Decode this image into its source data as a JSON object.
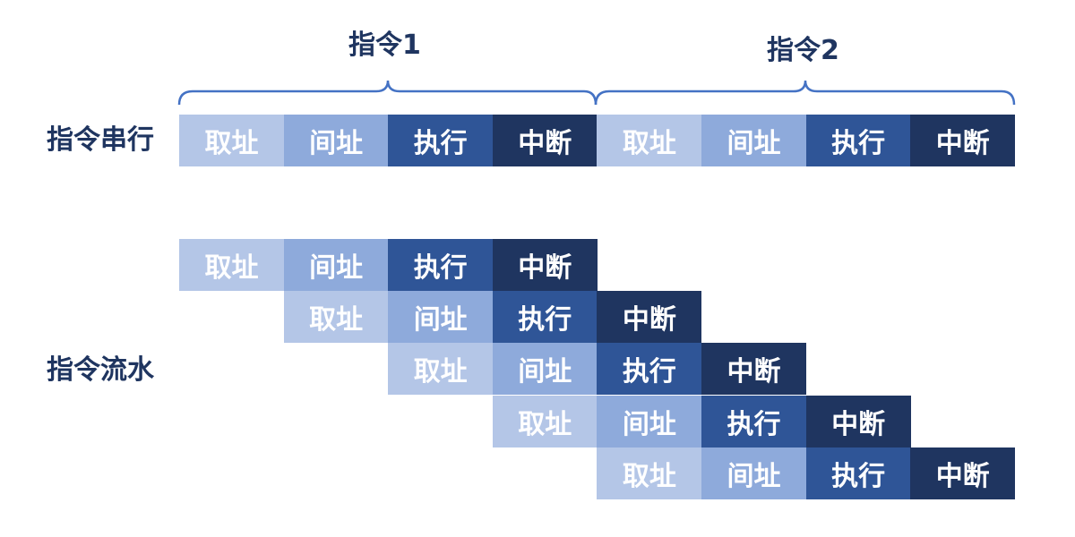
{
  "labels": {
    "instr1": "指令1",
    "instr2": "指令2",
    "serial": "指令串行",
    "pipeline": "指令流水"
  },
  "stages": {
    "fetch": "取址",
    "indirect": "间址",
    "execute": "执行",
    "interrupt": "中断"
  },
  "colors": {
    "fetch": "#b4c6e7",
    "indirect": "#8eaadb",
    "execute": "#2f5597",
    "interrupt": "#1f3560",
    "brace": "#4472c4",
    "text_dark": "#1f3560",
    "text_light": "#ffffff"
  },
  "serial_row": [
    "fetch",
    "indirect",
    "execute",
    "interrupt",
    "fetch",
    "indirect",
    "execute",
    "interrupt"
  ],
  "pipeline_rows": [
    [
      "fetch",
      "indirect",
      "execute",
      "interrupt"
    ],
    [
      "fetch",
      "indirect",
      "execute",
      "interrupt"
    ],
    [
      "fetch",
      "indirect",
      "execute",
      "interrupt"
    ],
    [
      "fetch",
      "indirect",
      "execute",
      "interrupt"
    ],
    [
      "fetch",
      "indirect",
      "execute",
      "interrupt"
    ]
  ]
}
